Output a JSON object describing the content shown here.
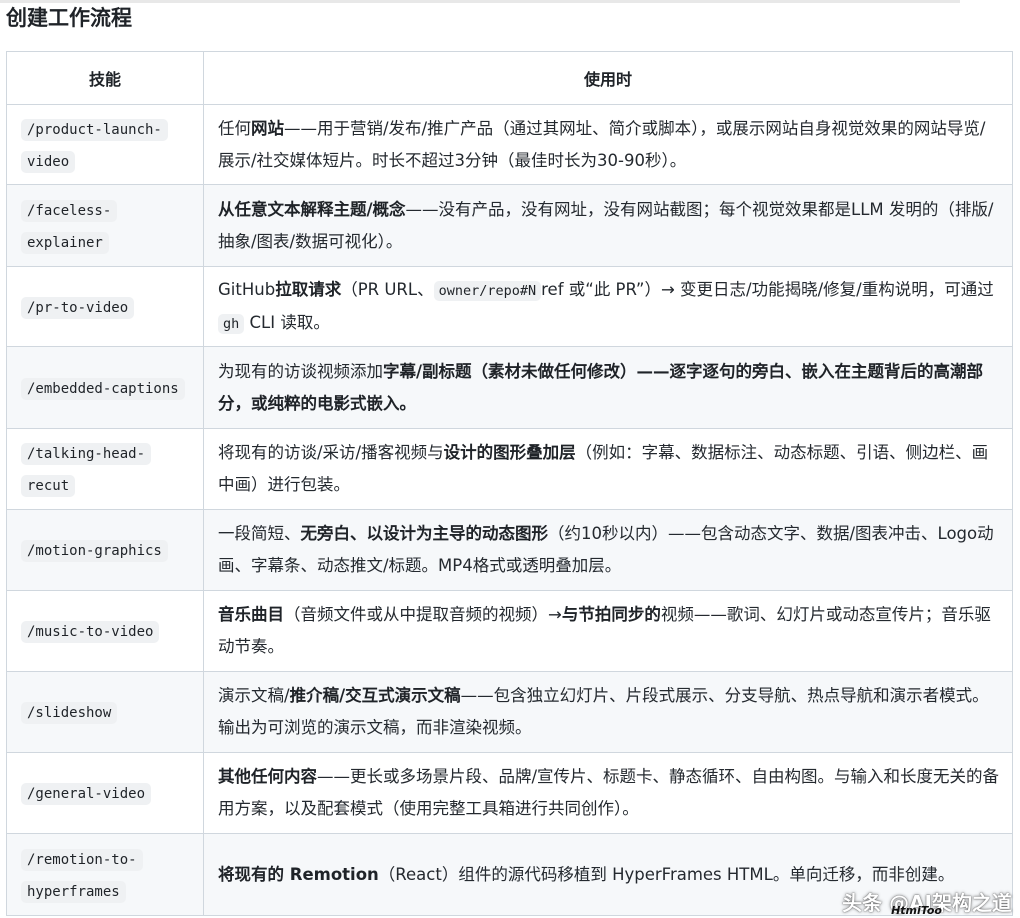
{
  "page": {
    "title": "创建工作流程"
  },
  "table": {
    "headers": [
      "技能",
      "使用时"
    ],
    "rows": [
      {
        "skill": "/product-launch-video",
        "desc": [
          {
            "t": "任何"
          },
          {
            "t": "网站",
            "b": true
          },
          {
            "t": "——用于营销/发布/推广产品（通过其网址、简介或脚本），或展示网站自身视觉效果的网站导览/展示/社交媒体短片。时长不超过3分钟（最佳时长为30-90秒）。"
          }
        ]
      },
      {
        "skill": "/faceless-explainer",
        "desc": [
          {
            "t": "从任意文本解释主题/概念",
            "b": true
          },
          {
            "t": "——没有产品，没有网址，没有网站截图；每个视觉效果都是LLM 发明的（排版/抽象/图表/数据可视化）。"
          }
        ]
      },
      {
        "skill": "/pr-to-video",
        "desc": [
          {
            "t": "GitHub"
          },
          {
            "t": "拉取请求",
            "b": true
          },
          {
            "t": "（PR URL、"
          },
          {
            "t": "owner/repo#N",
            "c": true
          },
          {
            "t": "ref 或“此 PR”）→ 变更日志/功能揭晓/修复/重构说明，可通过 "
          },
          {
            "t": "gh",
            "c": true
          },
          {
            "t": " CLI 读取。"
          }
        ]
      },
      {
        "skill": "/embedded-captions",
        "desc": [
          {
            "t": "为现有的访谈视频添加"
          },
          {
            "t": "字幕/副标题（素材未做任何修改）——逐字逐句的旁白、嵌入在主题背后的高潮部分，或纯粹的电影式嵌入。",
            "b": true
          }
        ]
      },
      {
        "skill": "/talking-head-recut",
        "desc": [
          {
            "t": "将现有的访谈/采访/播客视频与"
          },
          {
            "t": "设计的图形叠加层",
            "b": true
          },
          {
            "t": "（例如：字幕、数据标注、动态标题、引语、侧边栏、画中画）进行包装。"
          }
        ]
      },
      {
        "skill": "/motion-graphics",
        "desc": [
          {
            "t": "一段简短、"
          },
          {
            "t": "无旁白、以设计为主导的动态图形",
            "b": true
          },
          {
            "t": "（约10秒以内）——包含动态文字、数据/图表冲击、Logo动画、字幕条、动态推文/标题。MP4格式或透明叠加层。"
          }
        ]
      },
      {
        "skill": "/music-to-video",
        "desc": [
          {
            "t": "音乐曲目",
            "b": true
          },
          {
            "t": "（音频文件或从中提取音频的视频）→"
          },
          {
            "t": "与节拍同步的",
            "b": true
          },
          {
            "t": "视频——歌词、幻灯片或动态宣传片；音乐驱动节奏。"
          }
        ]
      },
      {
        "skill": "/slideshow",
        "desc": [
          {
            "t": "演示文稿/"
          },
          {
            "t": "推介稿/交互式演示文稿",
            "b": true
          },
          {
            "t": "——包含独立幻灯片、片段式展示、分支导航、热点导航和演示者模式。输出为可浏览的演示文稿，而非渲染视频。"
          }
        ]
      },
      {
        "skill": "/general-video",
        "desc": [
          {
            "t": "其他任何内容",
            "b": true
          },
          {
            "t": "——更长或多场景片段、品牌/宣传片、标题卡、静态循环、自由构图。与输入和长度无关的备用方案，以及配套模式（使用完整工具箱进行共同创作）。"
          }
        ]
      },
      {
        "skill": "/remotion-to-hyperframes",
        "desc": [
          {
            "t": "将现有的 Remotion",
            "b": true
          },
          {
            "t": "（React）组件的源代码移植到 HyperFrames HTML。单向迁移，而非创建。"
          }
        ]
      }
    ]
  },
  "watermark": {
    "main": "头条 @AI架构之道",
    "sub": "HtmiToo"
  }
}
